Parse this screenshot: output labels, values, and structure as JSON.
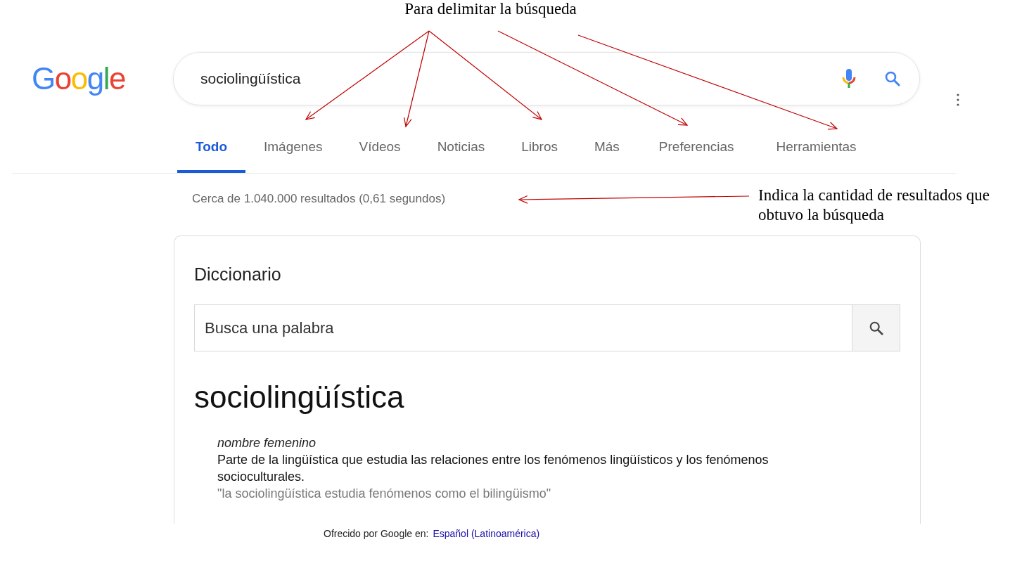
{
  "annotation_title": "Para delimitar la búsqueda",
  "logo": "Google",
  "search": {
    "value": "sociolingüística"
  },
  "tabs": [
    {
      "label": "Todo",
      "selected": true
    },
    {
      "label": "Imágenes",
      "selected": false
    },
    {
      "label": "Vídeos",
      "selected": false
    },
    {
      "label": "Noticias",
      "selected": false
    },
    {
      "label": "Libros",
      "selected": false
    },
    {
      "label": "Más",
      "selected": false
    },
    {
      "label": "Preferencias",
      "selected": false
    },
    {
      "label": "Herramientas",
      "selected": false
    }
  ],
  "result_stats": "Cerca de 1.040.000 resultados (0,61 segundos)",
  "annotation_note": "Indica la cantidad de resultados que obtuvo la búsqueda",
  "dictionary": {
    "title": "Diccionario",
    "search_placeholder": "Busca una palabra",
    "word": "sociolingüística",
    "part_of_speech": "nombre femenino",
    "definition": "Parte de la lingüística que estudia las relaciones entre los fenómenos lingüísticos y los fenómenos socioculturales.",
    "example": "\"la sociolingüística estudia fenómenos como el bilingüismo\""
  },
  "footer": {
    "prefix": "Ofrecido por Google en:",
    "language": "Español (Latinoamérica)"
  }
}
